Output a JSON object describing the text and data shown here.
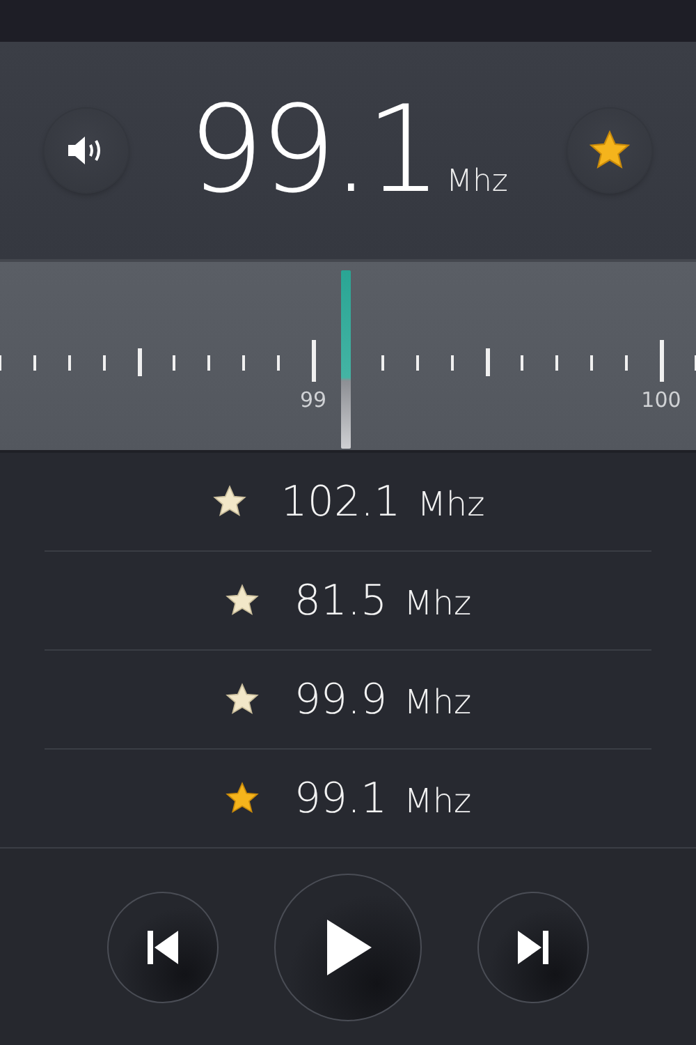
{
  "header": {
    "frequency": "99.1",
    "unit": "Mhz",
    "favorite": true
  },
  "dial": {
    "labels": [
      "99",
      "100"
    ],
    "level": 0.496
  },
  "stations": [
    {
      "frequency": "102.1",
      "unit": "Mhz",
      "favorite": false
    },
    {
      "frequency": "81.5",
      "unit": "Mhz",
      "favorite": false
    },
    {
      "frequency": "99.9",
      "unit": "Mhz",
      "favorite": false
    },
    {
      "frequency": "99.1",
      "unit": "Mhz",
      "favorite": true
    }
  ],
  "controls": {
    "playing": false
  }
}
